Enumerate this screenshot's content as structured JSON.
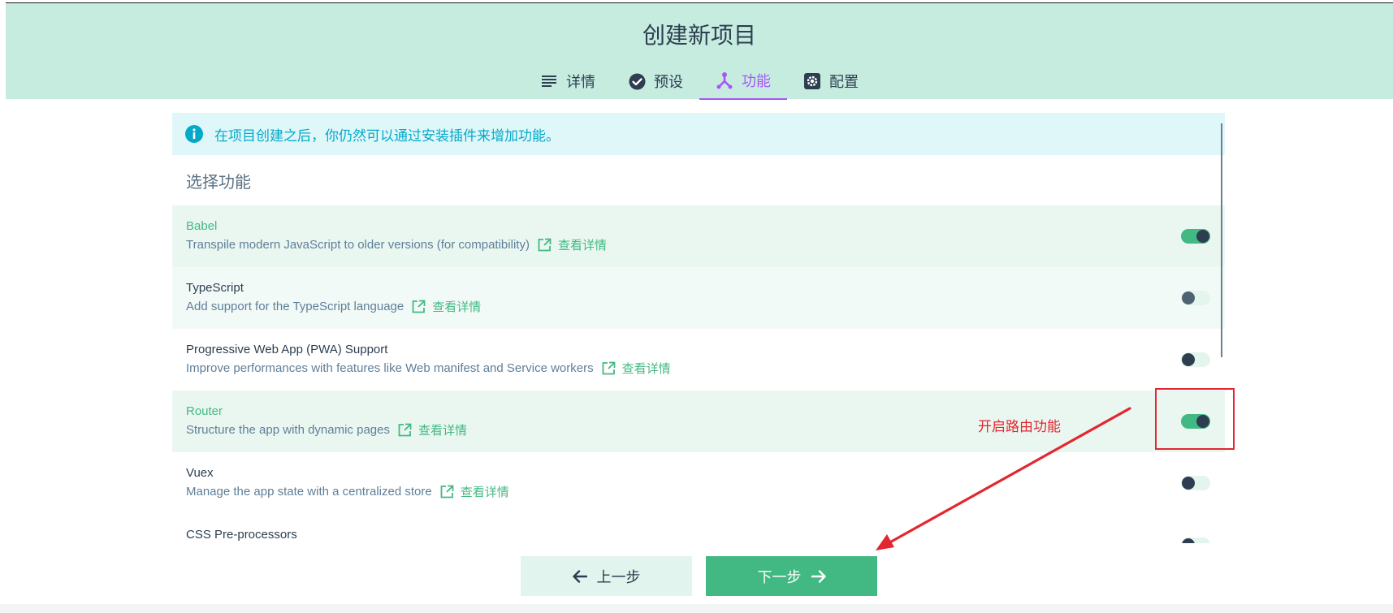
{
  "page_title": "创建新项目",
  "tabs": [
    {
      "label": "详情",
      "icon": "list-icon"
    },
    {
      "label": "预设",
      "icon": "check-circle-icon"
    },
    {
      "label": "功能",
      "icon": "fork-icon"
    },
    {
      "label": "配置",
      "icon": "gear-icon"
    }
  ],
  "active_tab": "功能",
  "info": {
    "text": "在项目创建之后，你仍然可以通过安装插件来增加功能。",
    "icon": "info-icon"
  },
  "section_title": "选择功能",
  "link_label": "查看详情",
  "features": [
    {
      "name": "Babel",
      "desc": "Transpile modern JavaScript to older versions (for compatibility)",
      "enabled": true
    },
    {
      "name": "TypeScript",
      "desc": "Add support for the TypeScript language",
      "enabled": false
    },
    {
      "name": "Progressive Web App (PWA) Support",
      "desc": "Improve performances with features like Web manifest and Service workers",
      "enabled": false
    },
    {
      "name": "Router",
      "desc": "Structure the app with dynamic pages",
      "enabled": true
    },
    {
      "name": "Vuex",
      "desc": "Manage the app state with a centralized store",
      "enabled": false
    },
    {
      "name": "CSS Pre-processors",
      "desc": "",
      "enabled": false
    }
  ],
  "buttons": {
    "prev": "上一步",
    "next": "下一步"
  },
  "annotation": {
    "text": "开启路由功能"
  },
  "colors": {
    "accent": "#42b983",
    "active_tab": "#a855f7",
    "info": "#03a9c9",
    "annotation": "#e3262f"
  }
}
